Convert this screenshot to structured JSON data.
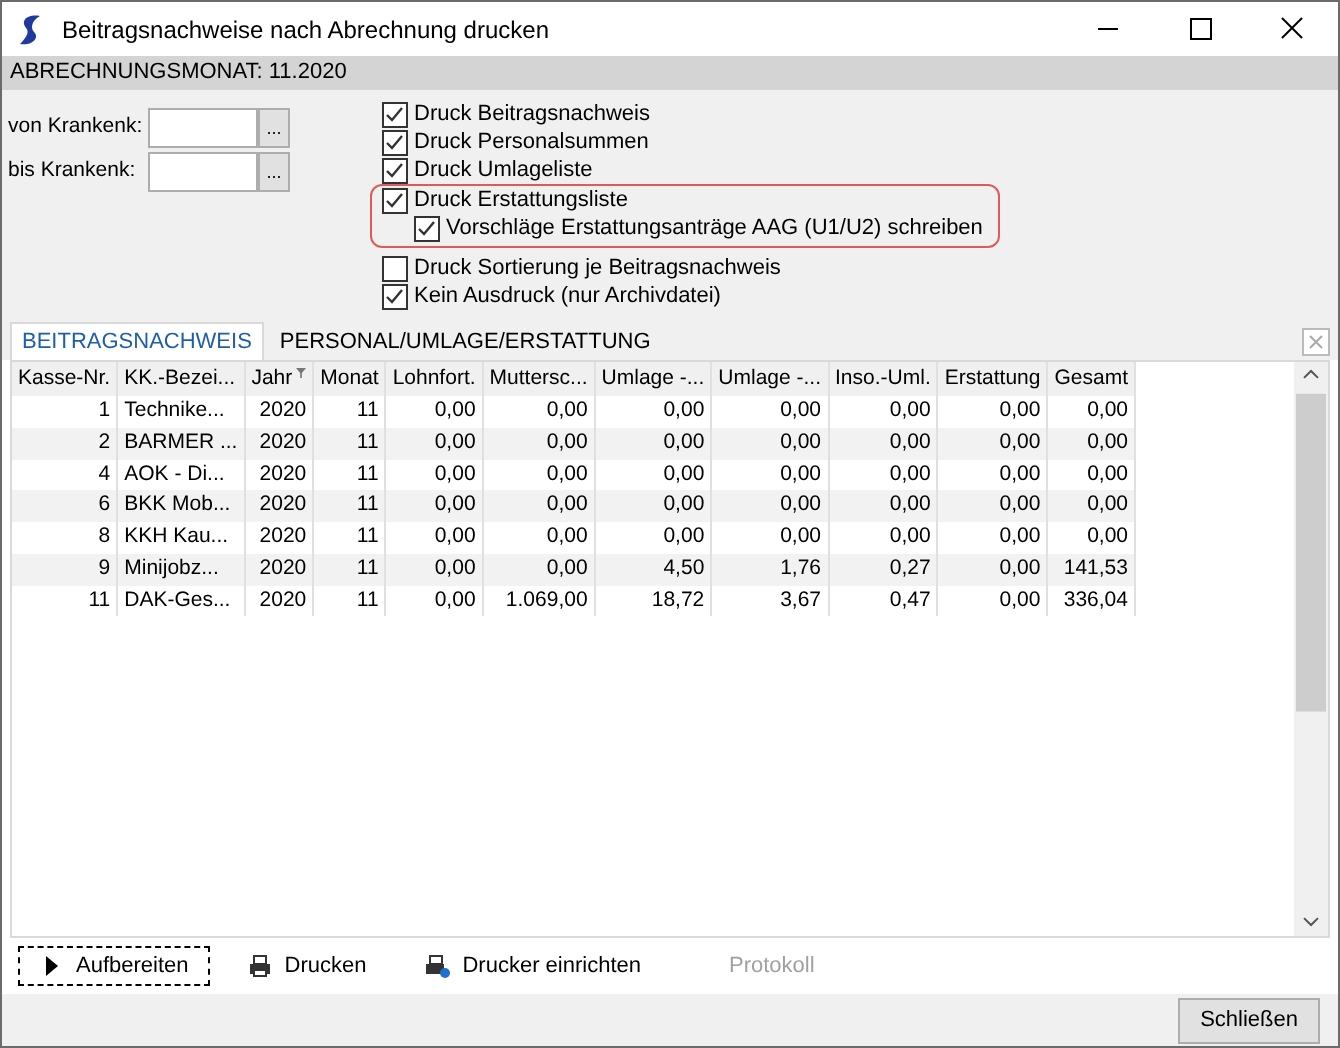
{
  "window": {
    "title": "Beitragsnachweise nach Abrechnung drucken"
  },
  "header": "ABRECHNUNGSMONAT: 11.2020",
  "range_fields": [
    {
      "label": "von Krankenk:",
      "button": "..."
    },
    {
      "label": "bis Krankenk:",
      "button": "..."
    }
  ],
  "options": [
    {
      "label": "Druck Beitragsnachweis",
      "checked": true,
      "highlighted": false
    },
    {
      "label": "Druck Personalsummen",
      "checked": true,
      "highlighted": false
    },
    {
      "label": "Druck Umlageliste",
      "checked": true,
      "highlighted": false
    },
    {
      "label": "Druck Erstattungsliste",
      "checked": true,
      "highlighted": true,
      "children": [
        {
          "label": "Vorschläge Erstattungsanträge AAG (U1/U2) schreiben",
          "checked": true
        }
      ]
    },
    {
      "label": "Druck Sortierung je Beitragsnachweis",
      "checked": false,
      "highlighted": false
    },
    {
      "label": "Kein Ausdruck (nur Archivdatei)",
      "checked": true,
      "highlighted": false
    }
  ],
  "tabs": [
    {
      "label": "BEITRAGSNACHWEIS",
      "selected": true
    },
    {
      "label": "PERSONAL/UMLAGE/ERSTATTUNG",
      "selected": false
    }
  ],
  "table": {
    "columns": [
      {
        "label": "Kasse-Nr.",
        "sorted": false
      },
      {
        "label": "KK.-Bezei...",
        "sorted": false
      },
      {
        "label": "Jahr",
        "sorted": true
      },
      {
        "label": "Monat",
        "sorted": false
      },
      {
        "label": "Lohnfort.",
        "sorted": false
      },
      {
        "label": "Muttersc...",
        "sorted": false
      },
      {
        "label": "Umlage -...",
        "sorted": false
      },
      {
        "label": "Umlage -...",
        "sorted": false
      },
      {
        "label": "Inso.-Uml.",
        "sorted": false
      },
      {
        "label": "Erstattung",
        "sorted": false
      },
      {
        "label": "Gesamt",
        "sorted": false
      }
    ],
    "rows": [
      [
        "1",
        "Technike...",
        "2020",
        "11",
        "0,00",
        "0,00",
        "0,00",
        "0,00",
        "0,00",
        "0,00",
        "0,00"
      ],
      [
        "2",
        "BARMER ...",
        "2020",
        "11",
        "0,00",
        "0,00",
        "0,00",
        "0,00",
        "0,00",
        "0,00",
        "0,00"
      ],
      [
        "4",
        "AOK - Di...",
        "2020",
        "11",
        "0,00",
        "0,00",
        "0,00",
        "0,00",
        "0,00",
        "0,00",
        "0,00"
      ],
      [
        "6",
        "BKK Mob...",
        "2020",
        "11",
        "0,00",
        "0,00",
        "0,00",
        "0,00",
        "0,00",
        "0,00",
        "0,00"
      ],
      [
        "8",
        "KKH Kau...",
        "2020",
        "11",
        "0,00",
        "0,00",
        "0,00",
        "0,00",
        "0,00",
        "0,00",
        "0,00"
      ],
      [
        "9",
        "Minijobz...",
        "2020",
        "11",
        "0,00",
        "0,00",
        "4,50",
        "1,76",
        "0,27",
        "0,00",
        "141,53"
      ],
      [
        "11",
        "DAK-Ges...",
        "2020",
        "11",
        "0,00",
        "1.069,00",
        "18,72",
        "3,67",
        "0,47",
        "0,00",
        "336,04"
      ]
    ]
  },
  "actions": [
    {
      "kind": "play",
      "label": "Aufbereiten",
      "focused": true,
      "disabled": false
    },
    {
      "kind": "print",
      "label": "Drucken",
      "focused": false,
      "disabled": false
    },
    {
      "kind": "printer-setup",
      "label": "Drucker einrichten",
      "focused": false,
      "disabled": false
    },
    {
      "kind": "none",
      "label": "Protokoll",
      "focused": false,
      "disabled": true
    }
  ],
  "close_button": "Schließen"
}
